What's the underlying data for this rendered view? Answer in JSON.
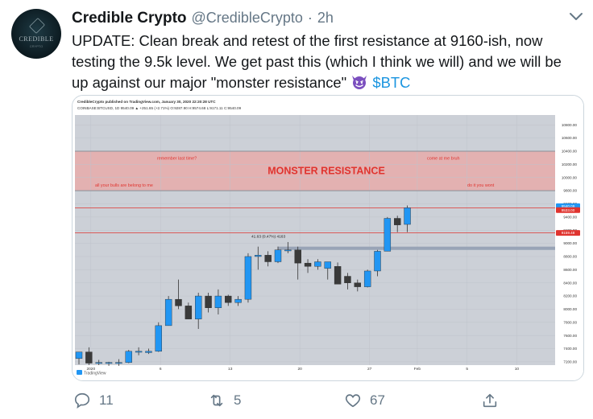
{
  "tweet": {
    "display_name": "Credible Crypto",
    "handle": "@CredibleCrypto",
    "separator": "·",
    "time": "2h",
    "avatar_text": "CREDIBLE",
    "avatar_subtext": "CRYPTO",
    "text_main": "UPDATE: Clean break and retest of the first resistance at 9160-ish, now testing the 9.5k level. We get past this (which I think we will) and we will be up against our major \"monster resistance\" ",
    "emoji": "smiling-imp-emoji",
    "cashtag": "$BTC",
    "actions": {
      "replies": "11",
      "retweets": "5",
      "likes": "67"
    }
  },
  "colors": {
    "accent": "#1b95e0",
    "muted": "#657786",
    "zone_fill": "#e3b1b1",
    "resistance_label": "#e0342f",
    "up_candle": "#2196f3",
    "down_candle": "#3a3a3a"
  },
  "chart": {
    "header_line1": "CredibleCrypto published on TradingView.com, January 30, 2020 22:20:28 UTC",
    "header_line2": "COINBASE:BTCUSD, 1D  9540.09  ▲ +251.65 (+2.71%)  O:9287.90  H:9574.68  L:9171.11  C:9540.09",
    "logo": "TradingView",
    "annotations": {
      "zone_title": "MONSTER RESISTANCE",
      "top_left": "remember last time?",
      "bottom_left": "all your bulls are belong to me",
      "top_right": "come at me bruh",
      "bottom_right": "do it you wont",
      "measure": "41.63 (0.47%) 4163"
    },
    "price_tags": {
      "current": "9540.09",
      "level2": "9533.00",
      "level1": "9159.48"
    }
  },
  "chart_data": {
    "type": "candlestick",
    "y_ticks": [
      "10800.00",
      "10600.00",
      "10400.00",
      "10200.00",
      "10000.00",
      "9800.00",
      "9600.00",
      "9400.00",
      "9200.00",
      "9000.00",
      "8800.00",
      "8600.00",
      "8400.00",
      "8200.00",
      "8000.00",
      "7800.00",
      "7600.00",
      "7400.00",
      "7200.00"
    ],
    "x_ticks": [
      "2020",
      "6",
      "13",
      "20",
      "27",
      "Feb",
      "5",
      "10"
    ],
    "ylim": [
      7150,
      10950
    ],
    "resistance_zone": [
      9800,
      10400
    ],
    "lines": [
      9540,
      9160,
      8950,
      8900
    ],
    "candles": [
      {
        "o": 7250,
        "h": 7350,
        "l": 7160,
        "c": 7350
      },
      {
        "o": 7350,
        "h": 7420,
        "l": 7150,
        "c": 7180
      },
      {
        "o": 7180,
        "h": 7230,
        "l": 7150,
        "c": 7190
      },
      {
        "o": 7190,
        "h": 7200,
        "l": 7140,
        "c": 7190
      },
      {
        "o": 7190,
        "h": 7240,
        "l": 7140,
        "c": 7190
      },
      {
        "o": 7190,
        "h": 7380,
        "l": 7180,
        "c": 7360
      },
      {
        "o": 7360,
        "h": 7420,
        "l": 7300,
        "c": 7360
      },
      {
        "o": 7340,
        "h": 7400,
        "l": 7320,
        "c": 7360
      },
      {
        "o": 7360,
        "h": 7800,
        "l": 7350,
        "c": 7750
      },
      {
        "o": 7750,
        "h": 8200,
        "l": 7750,
        "c": 8150
      },
      {
        "o": 8150,
        "h": 8450,
        "l": 8000,
        "c": 8050
      },
      {
        "o": 8050,
        "h": 8100,
        "l": 7850,
        "c": 7850
      },
      {
        "o": 7850,
        "h": 8250,
        "l": 7700,
        "c": 8200
      },
      {
        "o": 8200,
        "h": 8250,
        "l": 7950,
        "c": 8020
      },
      {
        "o": 8020,
        "h": 8300,
        "l": 7920,
        "c": 8200
      },
      {
        "o": 8200,
        "h": 8220,
        "l": 8050,
        "c": 8100
      },
      {
        "o": 8100,
        "h": 8200,
        "l": 8050,
        "c": 8150
      },
      {
        "o": 8150,
        "h": 8850,
        "l": 8100,
        "c": 8800
      },
      {
        "o": 8800,
        "h": 8950,
        "l": 8600,
        "c": 8820
      },
      {
        "o": 8820,
        "h": 8880,
        "l": 8650,
        "c": 8720
      },
      {
        "o": 8720,
        "h": 8950,
        "l": 8700,
        "c": 8900
      },
      {
        "o": 8900,
        "h": 9020,
        "l": 8850,
        "c": 8900
      },
      {
        "o": 8900,
        "h": 8950,
        "l": 8450,
        "c": 8700
      },
      {
        "o": 8700,
        "h": 8760,
        "l": 8550,
        "c": 8650
      },
      {
        "o": 8650,
        "h": 8760,
        "l": 8600,
        "c": 8720
      },
      {
        "o": 8620,
        "h": 8700,
        "l": 8450,
        "c": 8720
      },
      {
        "o": 8650,
        "h": 8710,
        "l": 8500,
        "c": 8380
      },
      {
        "o": 8500,
        "h": 8550,
        "l": 8300,
        "c": 8400
      },
      {
        "o": 8400,
        "h": 8450,
        "l": 8270,
        "c": 8340
      },
      {
        "o": 8340,
        "h": 8600,
        "l": 8330,
        "c": 8580
      },
      {
        "o": 8580,
        "h": 8900,
        "l": 8500,
        "c": 8880
      },
      {
        "o": 8880,
        "h": 9400,
        "l": 8880,
        "c": 9380
      },
      {
        "o": 9380,
        "h": 9420,
        "l": 9170,
        "c": 9280
      },
      {
        "o": 9288,
        "h": 9575,
        "l": 9171,
        "c": 9540
      }
    ]
  }
}
